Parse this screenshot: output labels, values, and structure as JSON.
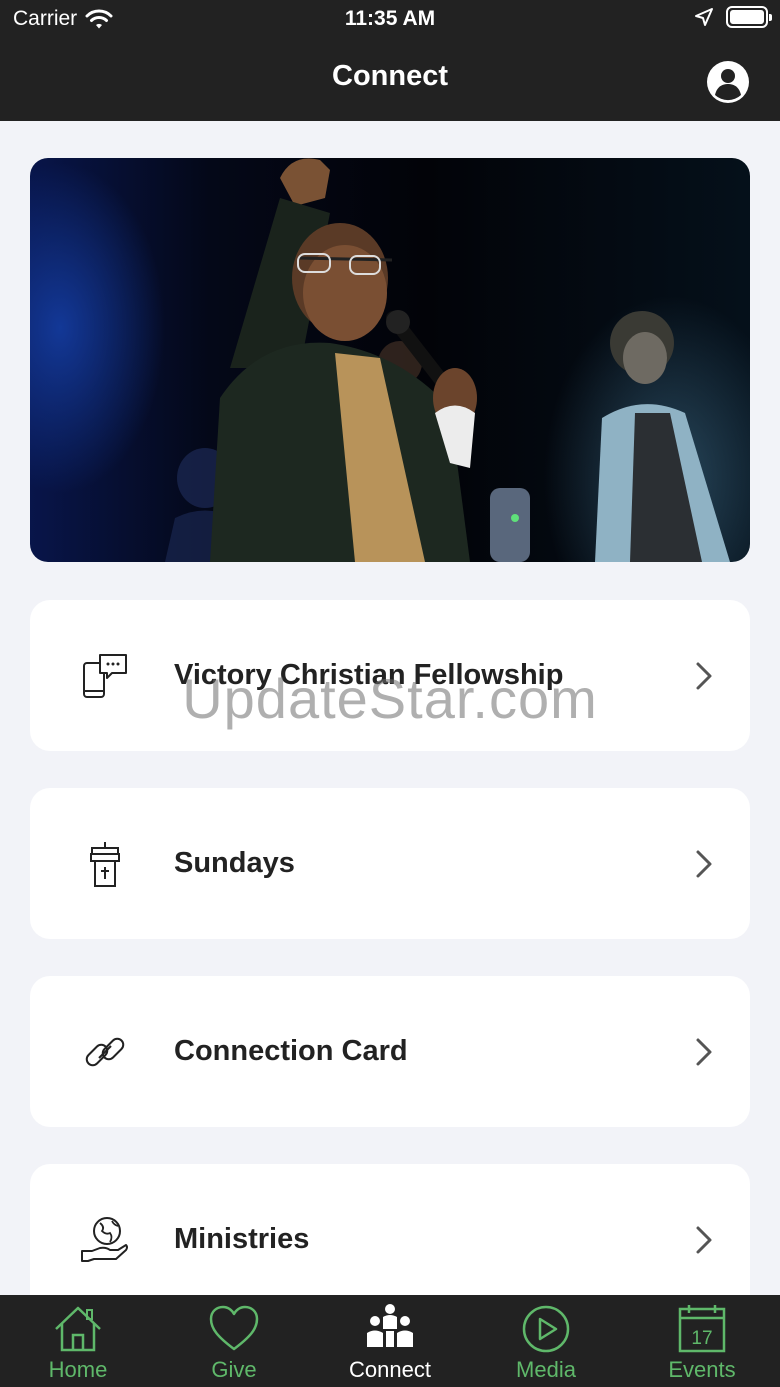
{
  "status_bar": {
    "carrier": "Carrier",
    "time": "11:35 AM"
  },
  "header": {
    "title": "Connect"
  },
  "hero": {
    "image": "worship-leader-photo"
  },
  "cards": [
    {
      "label": "Victory Christian Fellowship",
      "icon": "phone-chat-icon"
    },
    {
      "label": "Sundays",
      "icon": "pulpit-icon"
    },
    {
      "label": "Connection Card",
      "icon": "link-icon"
    },
    {
      "label": "Ministries",
      "icon": "globe-hand-icon"
    }
  ],
  "watermark": "UpdateStar.com",
  "tabbar": {
    "tabs": [
      {
        "label": "Home",
        "icon": "home-icon",
        "active": false
      },
      {
        "label": "Give",
        "icon": "heart-icon",
        "active": false
      },
      {
        "label": "Connect",
        "icon": "people-icon",
        "active": true
      },
      {
        "label": "Media",
        "icon": "play-icon",
        "active": false
      },
      {
        "label": "Events",
        "icon": "calendar-icon",
        "active": false,
        "calendar_day": "17"
      }
    ]
  },
  "colors": {
    "bar_background": "#222222",
    "page_background": "#f2f3f8",
    "tab_inactive": "#5fb86a",
    "tab_active": "#ffffff"
  }
}
